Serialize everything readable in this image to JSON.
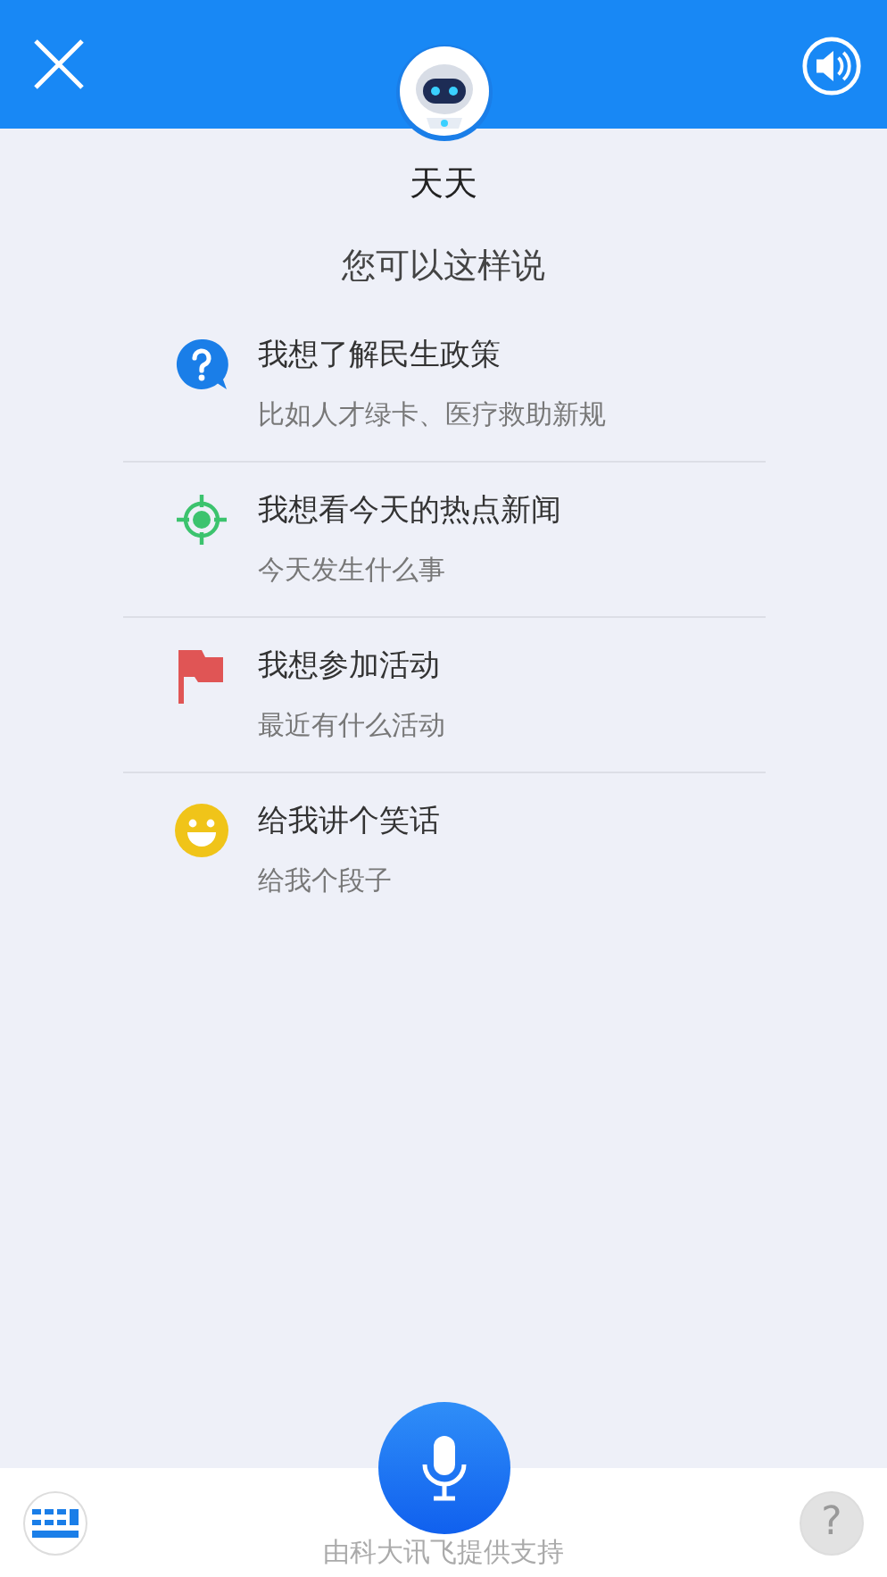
{
  "assistant": {
    "name": "天天"
  },
  "prompt": "您可以这样说",
  "suggestions": [
    {
      "kind": "question",
      "title": "我想了解民生政策",
      "hint": "比如人才绿卡、医疗救助新规"
    },
    {
      "kind": "target",
      "title": "我想看今天的热点新闻",
      "hint": "今天发生什么事"
    },
    {
      "kind": "flag",
      "title": "我想参加活动",
      "hint": "最近有什么活动"
    },
    {
      "kind": "smile",
      "title": "给我讲个笑话",
      "hint": "给我个段子"
    }
  ],
  "footer": {
    "credit": "由科大讯飞提供支持",
    "help": "?"
  }
}
